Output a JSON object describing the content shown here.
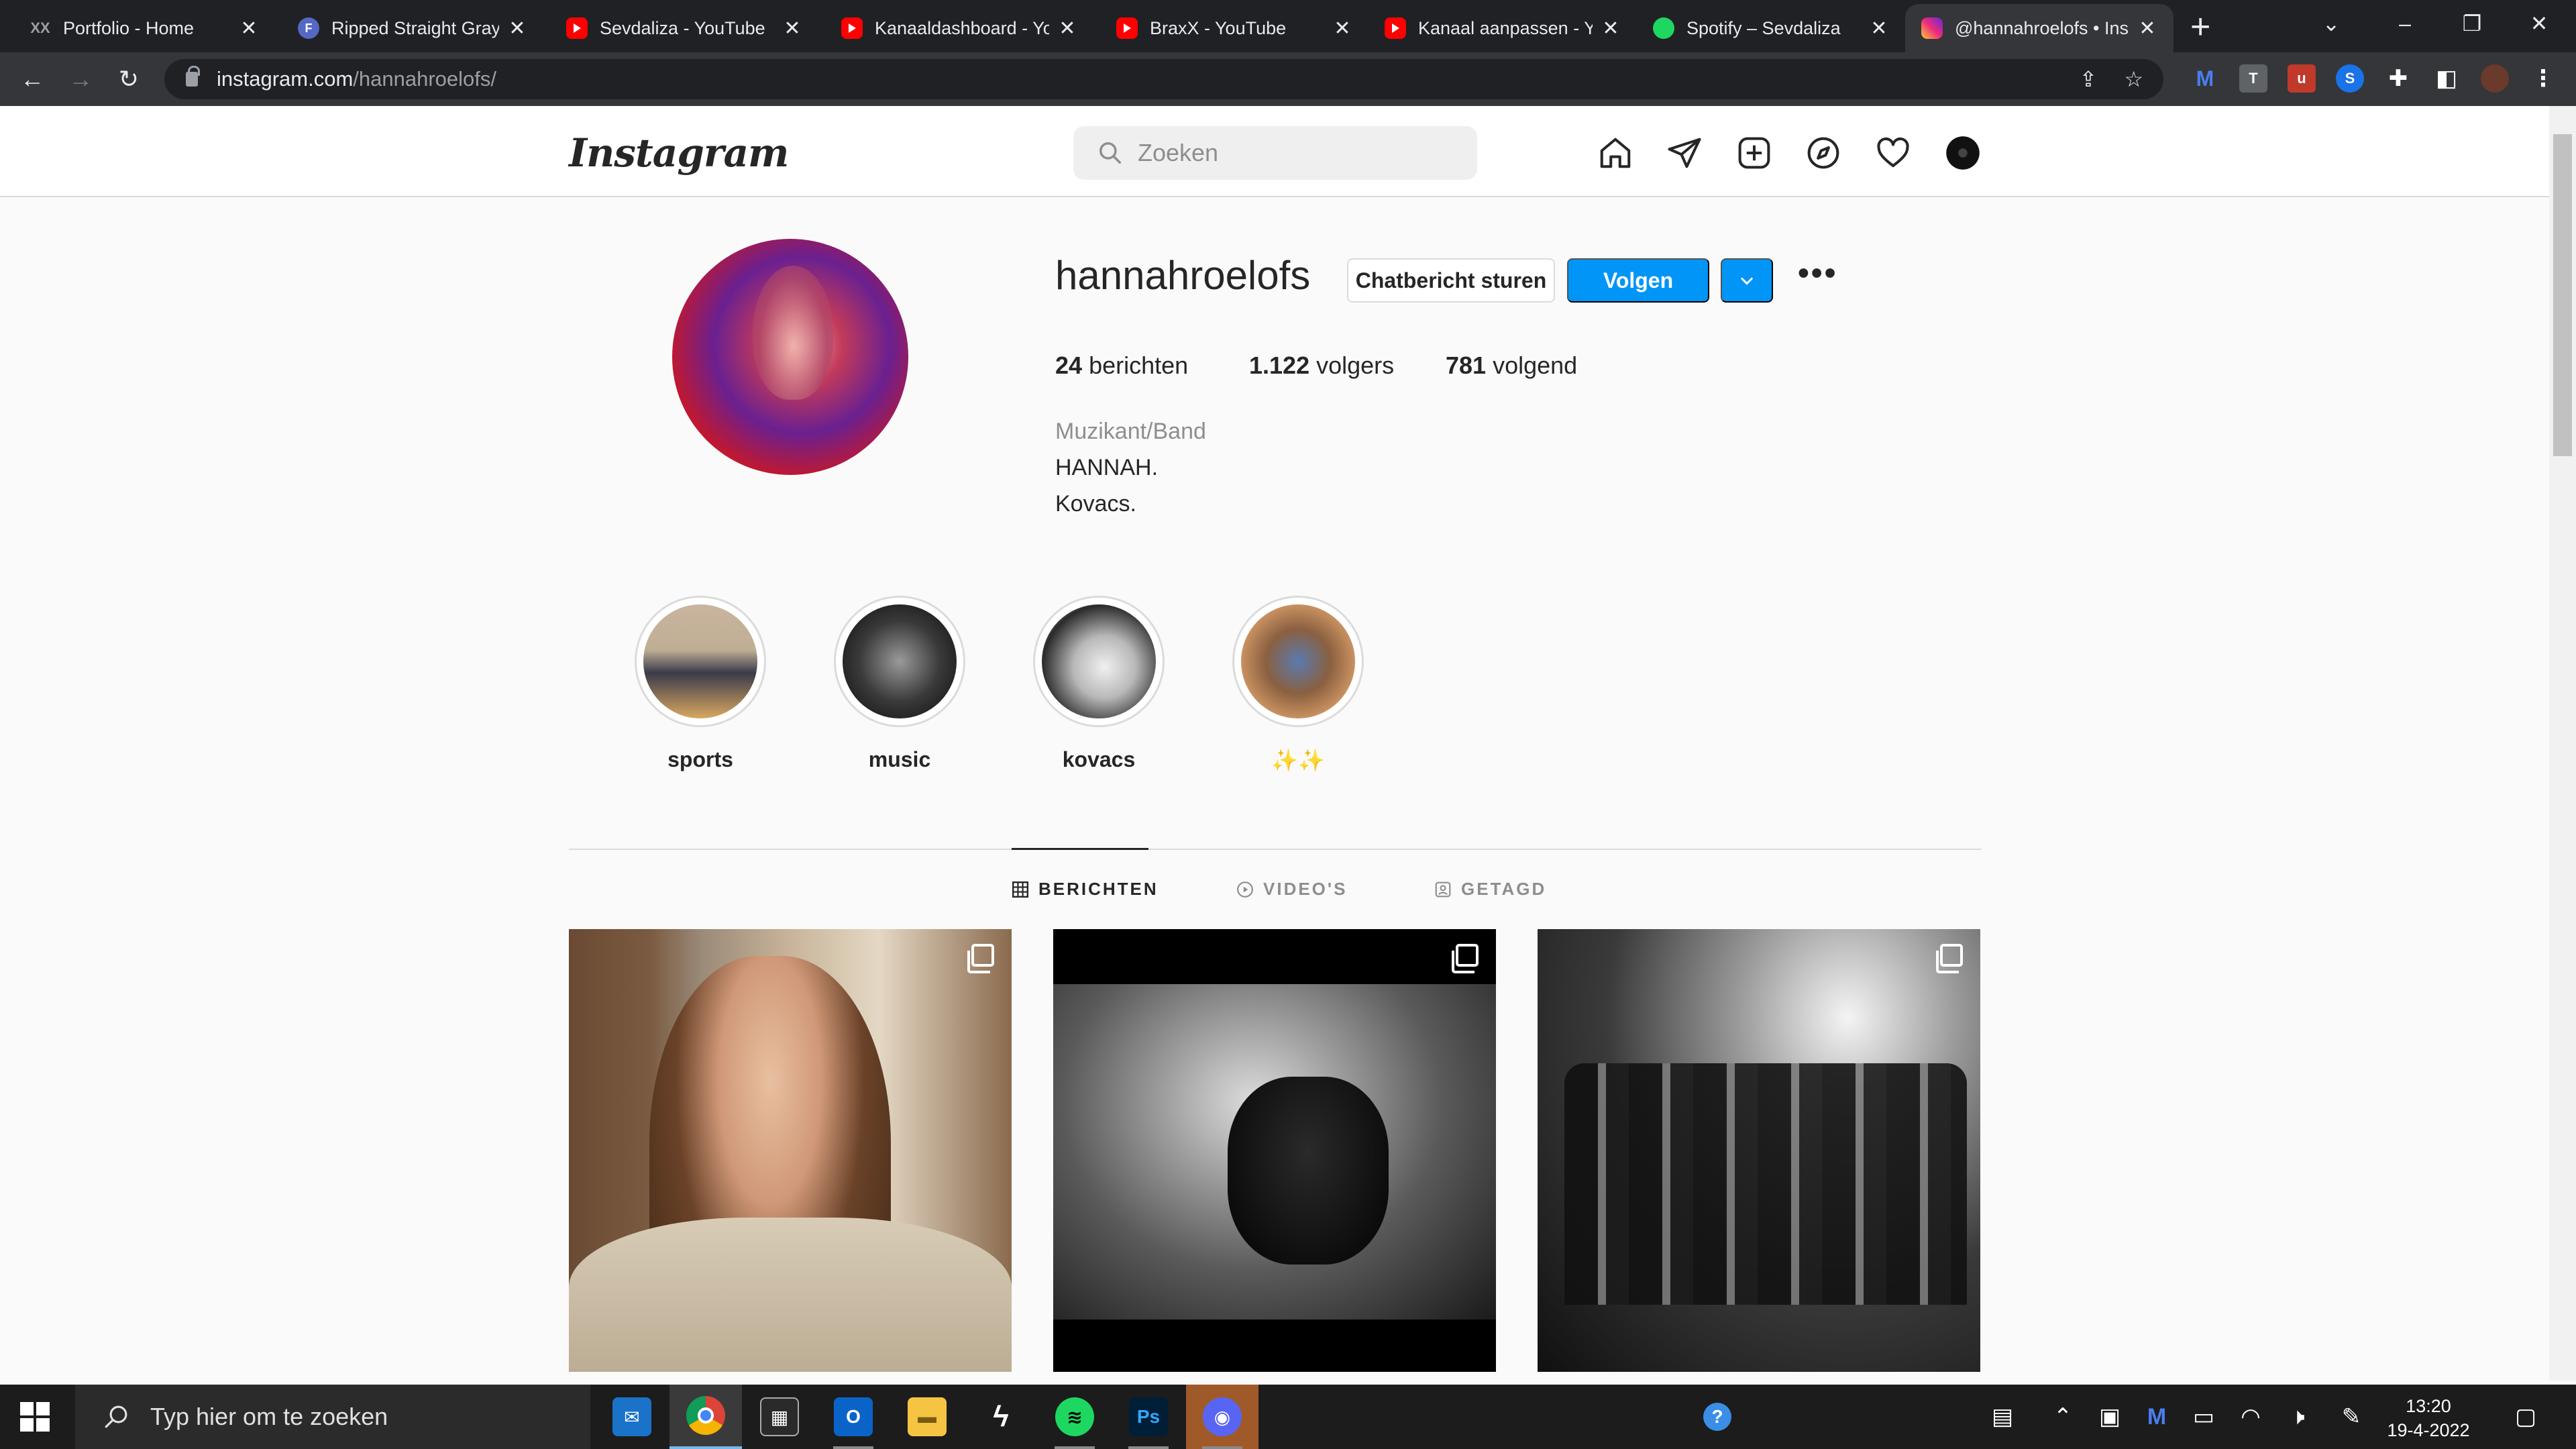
{
  "browser": {
    "tabs": [
      {
        "title": "Portfolio - Home",
        "favicon": "xx",
        "favicon_text": "XX"
      },
      {
        "title": "Ripped Straight Gray",
        "favicon": "fb",
        "favicon_text": "F"
      },
      {
        "title": "Sevdaliza - YouTube",
        "favicon": "yt",
        "favicon_text": ""
      },
      {
        "title": "Kanaaldashboard - Yo",
        "favicon": "yt",
        "favicon_text": ""
      },
      {
        "title": "BraxX - YouTube",
        "favicon": "yt",
        "favicon_text": ""
      },
      {
        "title": "Kanaal aanpassen - Yo",
        "favicon": "yt",
        "favicon_text": ""
      },
      {
        "title": "Spotify – Sevdaliza",
        "favicon": "sp",
        "favicon_text": ""
      },
      {
        "title": "@hannahroelofs • Ins",
        "favicon": "ig",
        "favicon_text": "",
        "active": true
      }
    ],
    "url_host": "instagram.com",
    "url_path": "/hannahroelofs/"
  },
  "instagram": {
    "logo": "Instagram",
    "search_placeholder": "Zoeken",
    "profile": {
      "username": "hannahroelofs",
      "message_button": "Chatbericht sturen",
      "follow_button": "Volgen",
      "stats": {
        "posts_count": "24",
        "posts_label": "berichten",
        "followers_count": "1.122",
        "followers_label": "volgers",
        "following_count": "781",
        "following_label": "volgend"
      },
      "category": "Muzikant/Band",
      "bio_lines": [
        "HANNAH.",
        "Kovacs."
      ]
    },
    "highlights": [
      {
        "label": "sports"
      },
      {
        "label": "music"
      },
      {
        "label": "kovacs"
      },
      {
        "label": "✨✨"
      }
    ],
    "tabs": [
      {
        "label": "BERICHTEN",
        "active": true
      },
      {
        "label": "VIDEO'S",
        "active": false
      },
      {
        "label": "GETAGD",
        "active": false
      }
    ]
  },
  "taskbar": {
    "search_placeholder": "Typ hier om te zoeken",
    "time": "13:20",
    "date": "19-4-2022"
  }
}
